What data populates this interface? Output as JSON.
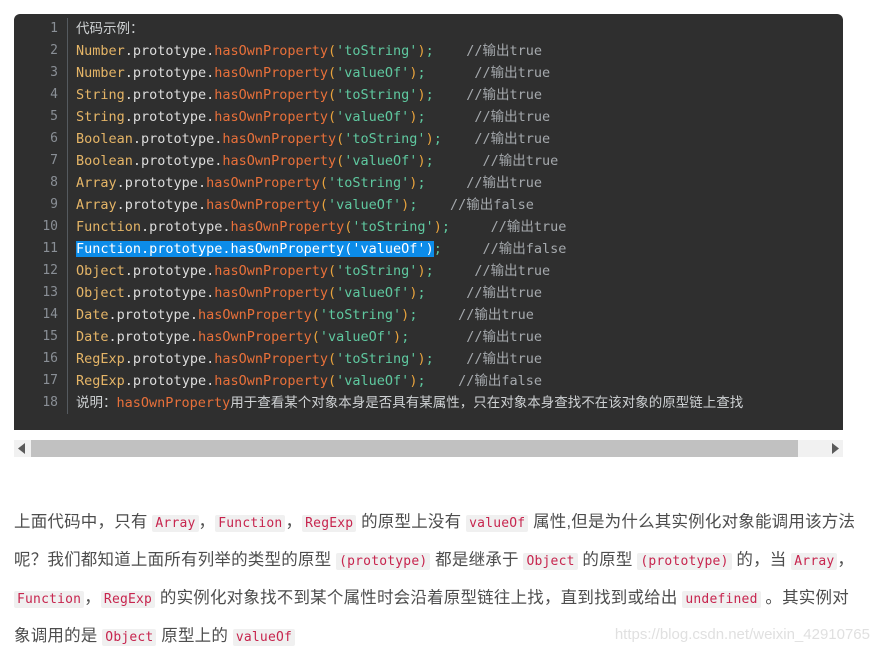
{
  "code_block": {
    "language": "javascript",
    "background": "#2f2f2f",
    "selection_color": "#0c8ce9",
    "lines": [
      {
        "num": "1",
        "kind": "plain",
        "text": "代码示例："
      },
      {
        "num": "2",
        "kind": "call",
        "cls": "Number",
        "dot1": ".",
        "prop": "prototype",
        "dot2": ".",
        "fn": "hasOwnProperty",
        "open": "(",
        "str": "'toString'",
        "close": ")",
        "semi": ";",
        "gap": "    ",
        "comment": "//输出true",
        "selected": false
      },
      {
        "num": "3",
        "kind": "call",
        "cls": "Number",
        "dot1": ".",
        "prop": "prototype",
        "dot2": ".",
        "fn": "hasOwnProperty",
        "open": "(",
        "str": "'valueOf'",
        "close": ")",
        "semi": ";",
        "gap": "      ",
        "comment": "//输出true",
        "selected": false
      },
      {
        "num": "4",
        "kind": "call",
        "cls": "String",
        "dot1": ".",
        "prop": "prototype",
        "dot2": ".",
        "fn": "hasOwnProperty",
        "open": "(",
        "str": "'toString'",
        "close": ")",
        "semi": ";",
        "gap": "    ",
        "comment": "//输出true",
        "selected": false
      },
      {
        "num": "5",
        "kind": "call",
        "cls": "String",
        "dot1": ".",
        "prop": "prototype",
        "dot2": ".",
        "fn": "hasOwnProperty",
        "open": "(",
        "str": "'valueOf'",
        "close": ")",
        "semi": ";",
        "gap": "      ",
        "comment": "//输出true",
        "selected": false
      },
      {
        "num": "6",
        "kind": "call",
        "cls": "Boolean",
        "dot1": ".",
        "prop": "prototype",
        "dot2": ".",
        "fn": "hasOwnProperty",
        "open": "(",
        "str": "'toString'",
        "close": ")",
        "semi": ";",
        "gap": "    ",
        "comment": "//输出true",
        "selected": false
      },
      {
        "num": "7",
        "kind": "call",
        "cls": "Boolean",
        "dot1": ".",
        "prop": "prototype",
        "dot2": ".",
        "fn": "hasOwnProperty",
        "open": "(",
        "str": "'valueOf'",
        "close": ")",
        "semi": ";",
        "gap": "      ",
        "comment": "//输出true",
        "selected": false
      },
      {
        "num": "8",
        "kind": "call",
        "cls": "Array",
        "dot1": ".",
        "prop": "prototype",
        "dot2": ".",
        "fn": "hasOwnProperty",
        "open": "(",
        "str": "'toString'",
        "close": ")",
        "semi": ";",
        "gap": "     ",
        "comment": "//输出true",
        "selected": false
      },
      {
        "num": "9",
        "kind": "call",
        "cls": "Array",
        "dot1": ".",
        "prop": "prototype",
        "dot2": ".",
        "fn": "hasOwnProperty",
        "open": "(",
        "str": "'valueOf'",
        "close": ")",
        "semi": ";",
        "gap": "    ",
        "comment": "//输出false",
        "selected": false
      },
      {
        "num": "10",
        "kind": "call",
        "cls": "Function",
        "dot1": ".",
        "prop": "prototype",
        "dot2": ".",
        "fn": "hasOwnProperty",
        "open": "(",
        "str": "'toString'",
        "close": ")",
        "semi": ";",
        "gap": "     ",
        "comment": "//输出true",
        "selected": false
      },
      {
        "num": "11",
        "kind": "call",
        "cls": "Function",
        "dot1": ".",
        "prop": "prototype",
        "dot2": ".",
        "fn": "hasOwnProperty",
        "open": "(",
        "str": "'valueOf'",
        "close": ")",
        "semi": ";",
        "gap": "     ",
        "comment": "//输出false",
        "selected": true
      },
      {
        "num": "12",
        "kind": "call",
        "cls": "Object",
        "dot1": ".",
        "prop": "prototype",
        "dot2": ".",
        "fn": "hasOwnProperty",
        "open": "(",
        "str": "'toString'",
        "close": ")",
        "semi": ";",
        "gap": "     ",
        "comment": "//输出true",
        "selected": false
      },
      {
        "num": "13",
        "kind": "call",
        "cls": "Object",
        "dot1": ".",
        "prop": "prototype",
        "dot2": ".",
        "fn": "hasOwnProperty",
        "open": "(",
        "str": "'valueOf'",
        "close": ")",
        "semi": ";",
        "gap": "     ",
        "comment": "//输出true",
        "selected": false
      },
      {
        "num": "14",
        "kind": "call",
        "cls": "Date",
        "dot1": ".",
        "prop": "prototype",
        "dot2": ".",
        "fn": "hasOwnProperty",
        "open": "(",
        "str": "'toString'",
        "close": ")",
        "semi": ";",
        "gap": "     ",
        "comment": "//输出true",
        "selected": false
      },
      {
        "num": "15",
        "kind": "call",
        "cls": "Date",
        "dot1": ".",
        "prop": "prototype",
        "dot2": ".",
        "fn": "hasOwnProperty",
        "open": "(",
        "str": "'valueOf'",
        "close": ")",
        "semi": ";",
        "gap": "       ",
        "comment": "//输出true",
        "selected": false
      },
      {
        "num": "16",
        "kind": "call",
        "cls": "RegExp",
        "dot1": ".",
        "prop": "prototype",
        "dot2": ".",
        "fn": "hasOwnProperty",
        "open": "(",
        "str": "'toString'",
        "close": ")",
        "semi": ";",
        "gap": "    ",
        "comment": "//输出true",
        "selected": false
      },
      {
        "num": "17",
        "kind": "call",
        "cls": "RegExp",
        "dot1": ".",
        "prop": "prototype",
        "dot2": ".",
        "fn": "hasOwnProperty",
        "open": "(",
        "str": "'valueOf'",
        "close": ")",
        "semi": ";",
        "gap": "    ",
        "comment": "//输出false",
        "selected": false
      },
      {
        "num": "18",
        "kind": "note",
        "note_prefix": "说明：",
        "note_kw": "hasOwnProperty",
        "note_suffix": "用于查看某个对象本身是否具有某属性，只在对象本身查找不在该对象的原型链上查找"
      }
    ]
  },
  "scrollbar": {
    "left_arrow": "◀",
    "right_arrow": "▶",
    "thumb_percent": 96.5,
    "orientation": "horizontal"
  },
  "paragraph": {
    "segments": [
      {
        "type": "text",
        "value": "上面代码中，只有 "
      },
      {
        "type": "code",
        "value": "Array"
      },
      {
        "type": "text",
        "value": "，"
      },
      {
        "type": "code",
        "value": "Function"
      },
      {
        "type": "text",
        "value": "，"
      },
      {
        "type": "code",
        "value": "RegExp"
      },
      {
        "type": "text",
        "value": " 的原型上没有 "
      },
      {
        "type": "code",
        "value": "valueOf"
      },
      {
        "type": "text",
        "value": " 属性,但是为什么其实例化对象能调用该方法呢？我们都知道上面所有列举的类型的原型 "
      },
      {
        "type": "code",
        "value": "(prototype)"
      },
      {
        "type": "text",
        "value": " 都是继承于 "
      },
      {
        "type": "code",
        "value": "Object"
      },
      {
        "type": "text",
        "value": " 的原型 "
      },
      {
        "type": "code",
        "value": "(prototype)"
      },
      {
        "type": "text",
        "value": " 的，当 "
      },
      {
        "type": "code",
        "value": "Array"
      },
      {
        "type": "text",
        "value": "，"
      },
      {
        "type": "code",
        "value": "Function"
      },
      {
        "type": "text",
        "value": "，"
      },
      {
        "type": "code",
        "value": "RegExp"
      },
      {
        "type": "text",
        "value": " 的实例化对象找不到某个属性时会沿着原型链往上找，直到找到或给出 "
      },
      {
        "type": "code",
        "value": "undefined"
      },
      {
        "type": "text",
        "value": " 。其实例对象调用的是 "
      },
      {
        "type": "code",
        "value": "Object"
      },
      {
        "type": "text",
        "value": " 原型上的 "
      },
      {
        "type": "code",
        "value": "valueOf"
      }
    ]
  },
  "watermark": {
    "text": "https://blog.csdn.net/weixin_42910765"
  }
}
